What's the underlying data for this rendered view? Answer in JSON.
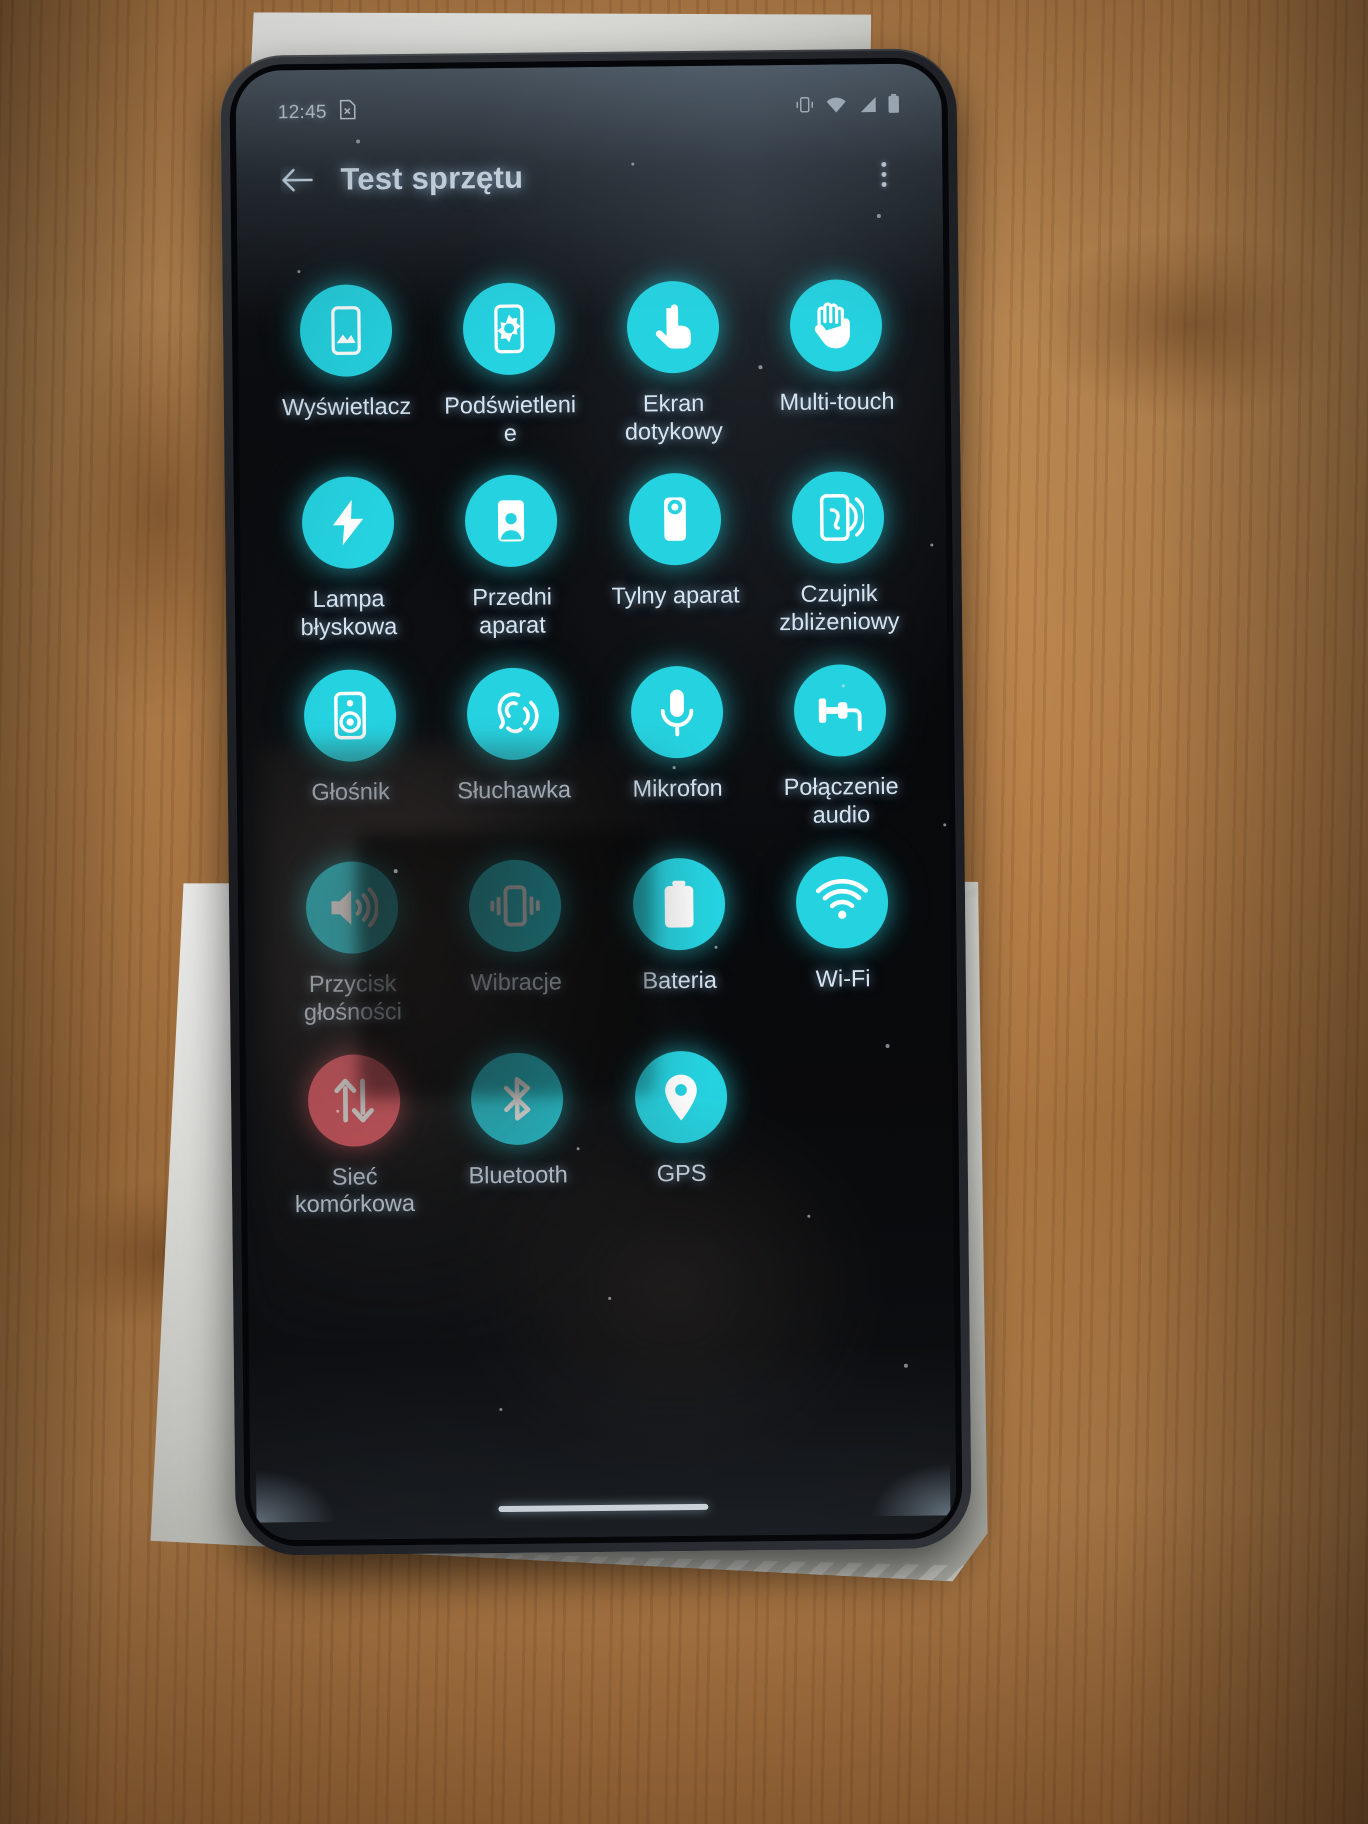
{
  "scene": {
    "description": "photo-of-phone-on-wooden-desk"
  },
  "statusbar": {
    "time": "12:45",
    "left_icons": [
      "sim-card-missing-icon"
    ],
    "right_icons": [
      "vibrate-icon",
      "wifi-icon",
      "signal-icon",
      "battery-icon"
    ]
  },
  "appbar": {
    "back_label": "←",
    "title": "Test sprzętu",
    "overflow_label": "⋮"
  },
  "accent": {
    "tile_cyan": "#25d2e0",
    "tile_red": "#f4626e",
    "label_color": "#d4e4f2",
    "screen_bg": "#08090b"
  },
  "grid": {
    "tiles": [
      {
        "label": "Wyświetlacz",
        "icon": "display-icon",
        "color": "cyan"
      },
      {
        "label": "Podświetlenie",
        "icon": "brightness-icon",
        "color": "cyan"
      },
      {
        "label": "Ekran dotykowy",
        "icon": "touchscreen-icon",
        "color": "cyan"
      },
      {
        "label": "Multi-touch",
        "icon": "multitouch-hand-icon",
        "color": "cyan"
      },
      {
        "label": "Lampa błyskowa",
        "icon": "flash-icon",
        "color": "cyan"
      },
      {
        "label": "Przedni aparat",
        "icon": "front-camera-icon",
        "color": "cyan"
      },
      {
        "label": "Tylny aparat",
        "icon": "rear-camera-icon",
        "color": "cyan"
      },
      {
        "label": "Czujnik zbliżeniowy",
        "icon": "proximity-sensor-icon",
        "color": "cyan"
      },
      {
        "label": "Głośnik",
        "icon": "speaker-icon",
        "color": "cyan"
      },
      {
        "label": "Słuchawka",
        "icon": "earpiece-icon",
        "color": "cyan"
      },
      {
        "label": "Mikrofon",
        "icon": "microphone-icon",
        "color": "cyan"
      },
      {
        "label": "Połączenie audio",
        "icon": "audio-jack-icon",
        "color": "cyan"
      },
      {
        "label": "Przycisk głośności",
        "icon": "volume-up-icon",
        "color": "cyan"
      },
      {
        "label": "Wibracje",
        "icon": "vibration-icon",
        "color": "cyan"
      },
      {
        "label": "Bateria",
        "icon": "battery-full-icon",
        "color": "cyan"
      },
      {
        "label": "Wi-Fi",
        "icon": "wifi-icon",
        "color": "cyan"
      },
      {
        "label": "Sieć komórkowa",
        "icon": "mobile-data-icon",
        "color": "red"
      },
      {
        "label": "Bluetooth",
        "icon": "bluetooth-icon",
        "color": "cyan"
      },
      {
        "label": "GPS",
        "icon": "location-pin-icon",
        "color": "cyan"
      }
    ]
  },
  "navigation": {
    "gesture_bar": "home-gesture-bar"
  }
}
